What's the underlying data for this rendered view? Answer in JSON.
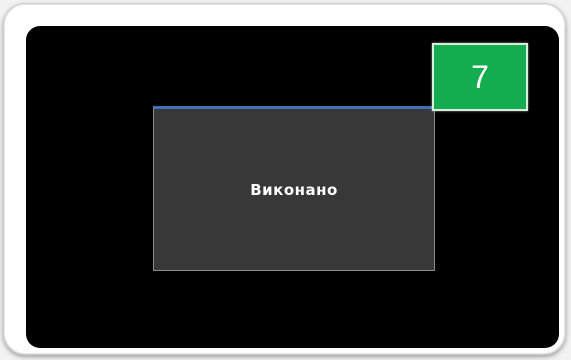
{
  "dialog": {
    "message": "Виконано"
  },
  "badge": {
    "step_number": "7"
  },
  "colors": {
    "badge_background": "#13ad4f",
    "dialog_background": "#383838",
    "dialog_accent": "#3f6fb8",
    "screen_background": "#000000"
  }
}
